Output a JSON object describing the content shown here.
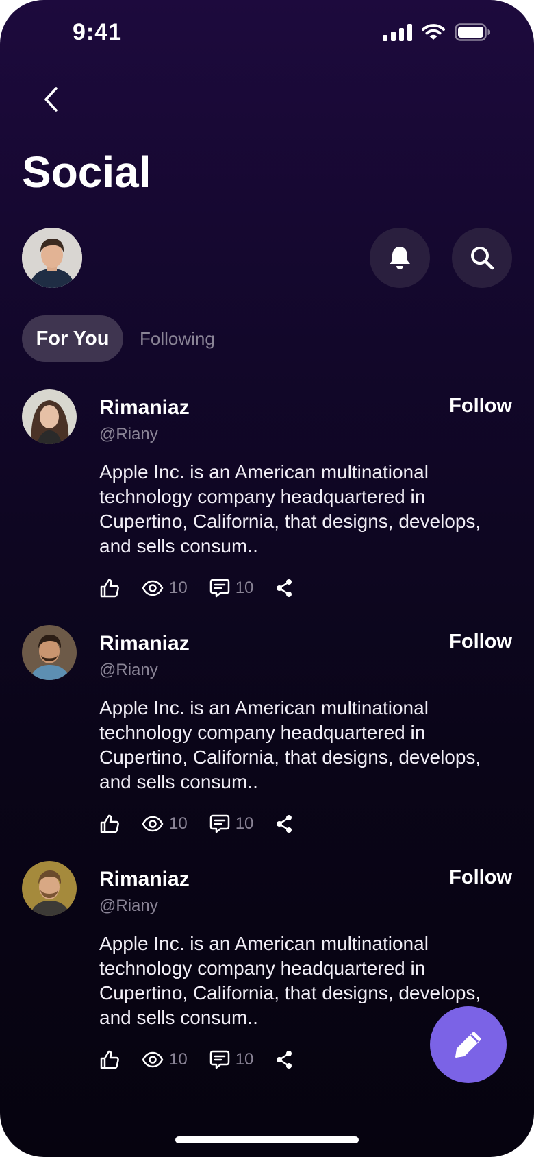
{
  "status_bar": {
    "time": "9:41"
  },
  "header": {
    "title": "Social"
  },
  "tabs": [
    {
      "label": "For You",
      "active": true
    },
    {
      "label": "Following",
      "active": false
    }
  ],
  "posts": [
    {
      "name": "Rimaniaz",
      "handle": "@Riany",
      "follow_label": "Follow",
      "body": "Apple Inc. is an American multinational technology company headquartered in Cupertino, California, that designs, develops, and sells consum..",
      "views": "10",
      "comments": "10"
    },
    {
      "name": "Rimaniaz",
      "handle": "@Riany",
      "follow_label": "Follow",
      "body": "Apple Inc. is an American multinational technology company headquartered in Cupertino, California, that designs, develops, and sells consum..",
      "views": "10",
      "comments": "10"
    },
    {
      "name": "Rimaniaz",
      "handle": "@Riany",
      "follow_label": "Follow",
      "body": "Apple Inc. is an American multinational technology company headquartered in Cupertino, California, that designs, develops, and sells consum..",
      "views": "10",
      "comments": "10"
    }
  ],
  "icons": {
    "back": "chevron-left-icon",
    "notifications": "bell-icon",
    "search": "search-icon",
    "like": "thumbs-up-icon",
    "views": "eye-icon",
    "comments": "comment-icon",
    "share": "share-icon",
    "compose": "pencil-icon"
  },
  "colors": {
    "background_top": "#1d0a3d",
    "background_bottom": "#06030f",
    "accent": "#7b63e6",
    "muted_text": "#8a8496",
    "chip": "#3f3550"
  }
}
